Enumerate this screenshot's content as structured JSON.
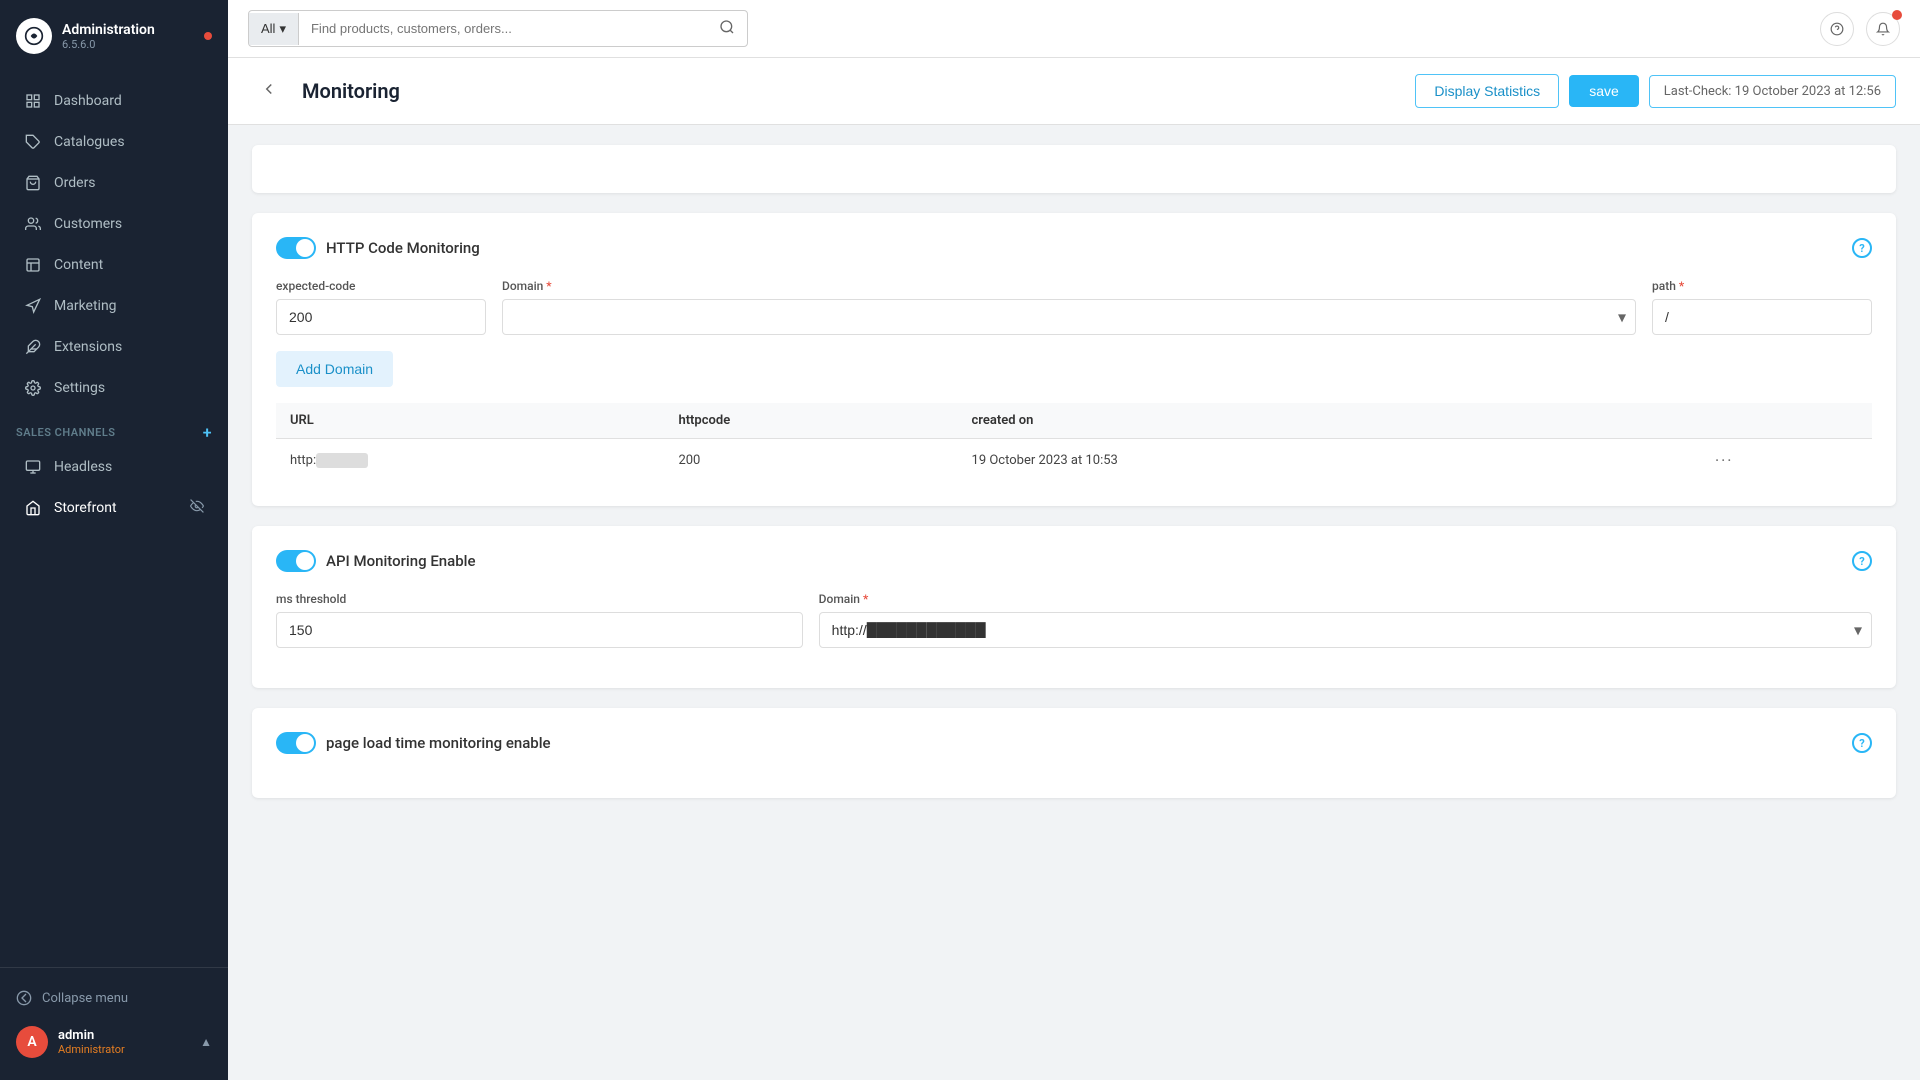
{
  "app": {
    "name": "Administration",
    "version": "6.5.6.0"
  },
  "sidebar": {
    "nav_items": [
      {
        "id": "dashboard",
        "label": "Dashboard",
        "icon": "grid"
      },
      {
        "id": "catalogues",
        "label": "Catalogues",
        "icon": "tag"
      },
      {
        "id": "orders",
        "label": "Orders",
        "icon": "shopping-bag"
      },
      {
        "id": "customers",
        "label": "Customers",
        "icon": "users"
      },
      {
        "id": "content",
        "label": "Content",
        "icon": "layout"
      },
      {
        "id": "marketing",
        "label": "Marketing",
        "icon": "megaphone"
      },
      {
        "id": "extensions",
        "label": "Extensions",
        "icon": "puzzle"
      },
      {
        "id": "settings",
        "label": "Settings",
        "icon": "gear"
      }
    ],
    "sales_channels_label": "Sales Channels",
    "sales_channel_items": [
      {
        "id": "headless",
        "label": "Headless",
        "icon": "headless"
      },
      {
        "id": "storefront",
        "label": "Storefront",
        "icon": "storefront",
        "active": true
      }
    ],
    "collapse_label": "Collapse menu",
    "user": {
      "name": "admin",
      "role": "Administrator",
      "avatar": "A"
    }
  },
  "topbar": {
    "search_dropdown": "All",
    "search_placeholder": "Find products, customers, orders..."
  },
  "page": {
    "title": "Monitoring",
    "btn_display_stats": "Display Statistics",
    "btn_save": "save",
    "last_check": "Last-Check: 19 October 2023 at 12:56"
  },
  "http_monitoring": {
    "toggle": true,
    "label": "HTTP Code Monitoring",
    "fields": {
      "expected_code_label": "expected-code",
      "expected_code_value": "200",
      "domain_label": "Domain",
      "domain_required": true,
      "path_label": "path",
      "path_required": true,
      "path_value": "/"
    },
    "btn_add_domain": "Add Domain",
    "table": {
      "columns": [
        "URL",
        "httpcode",
        "created on",
        "",
        ""
      ],
      "rows": [
        {
          "url": "http://████████████",
          "httpcode": "200",
          "created_on": "19 October 2023 at 10:53",
          "actions": "···"
        }
      ]
    }
  },
  "api_monitoring": {
    "toggle": true,
    "label": "API Monitoring Enable",
    "fields": {
      "ms_threshold_label": "ms threshold",
      "ms_threshold_value": "150",
      "domain_label": "Domain",
      "domain_required": true,
      "domain_value": "http://"
    }
  },
  "page_load_monitoring": {
    "toggle": true,
    "label": "page load time monitoring enable"
  }
}
